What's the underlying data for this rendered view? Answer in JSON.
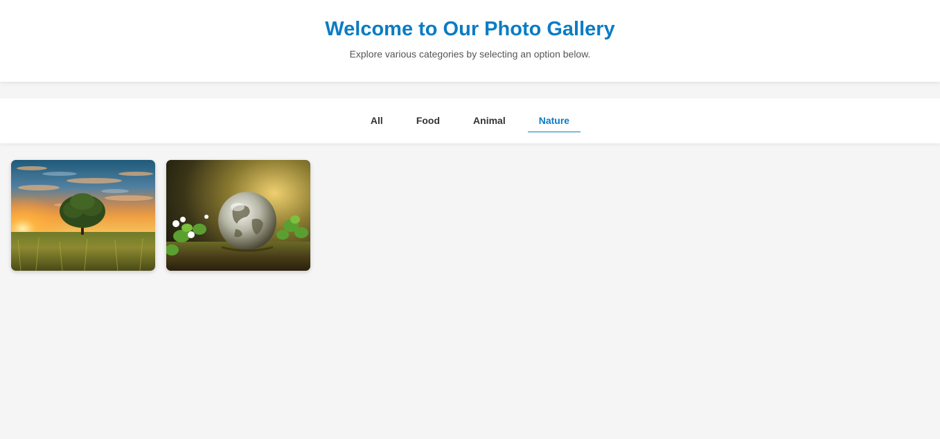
{
  "header": {
    "title": "Welcome to Our Photo Gallery",
    "subtitle": "Explore various categories by selecting an option below."
  },
  "filters": {
    "tabs": [
      {
        "label": "All",
        "active": false
      },
      {
        "label": "Food",
        "active": false
      },
      {
        "label": "Animal",
        "active": false
      },
      {
        "label": "Nature",
        "active": true
      }
    ]
  },
  "gallery": {
    "category": "Nature",
    "images": [
      {
        "subject": "lone tree in grassy field at sunset"
      },
      {
        "subject": "glass globe on moss with clover leaves"
      }
    ]
  },
  "colors": {
    "accent": "#0a7cc4",
    "background": "#f5f5f5",
    "text": "#333333"
  }
}
